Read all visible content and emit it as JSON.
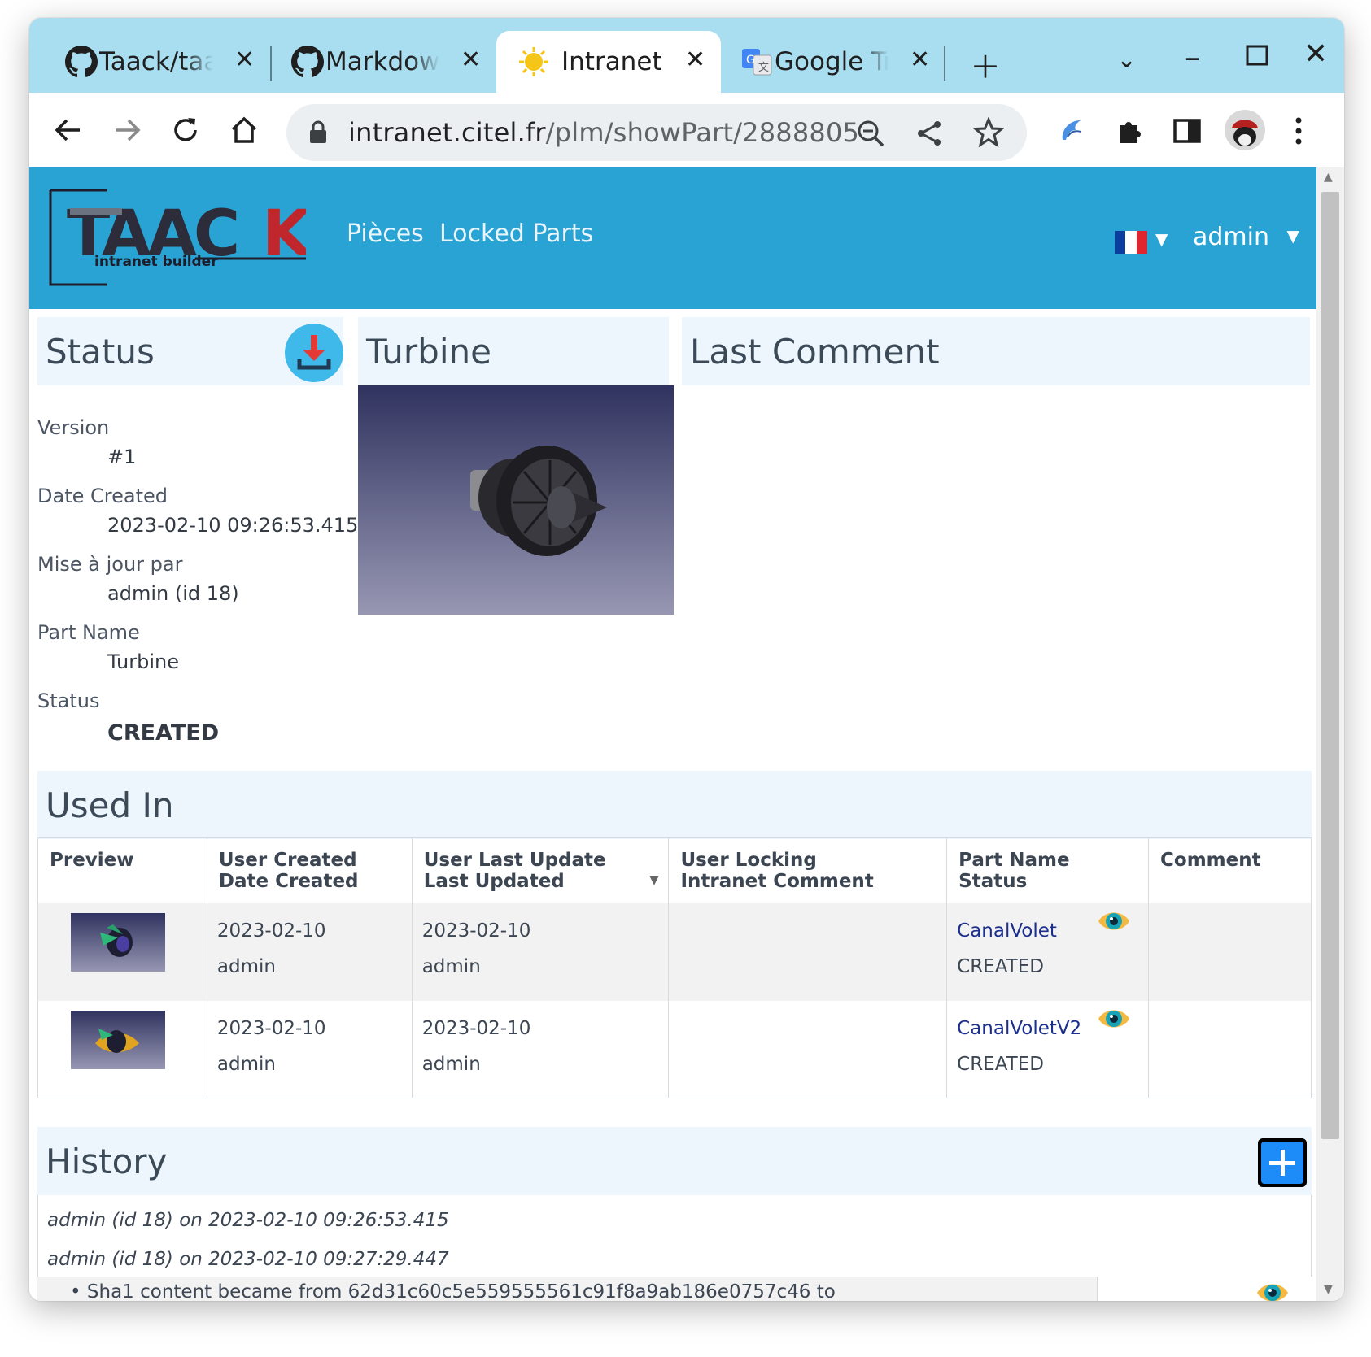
{
  "browser": {
    "tabs": [
      {
        "title": "Taack/taack-ui",
        "icon": "github-icon"
      },
      {
        "title": "Markdown",
        "icon": "github-icon"
      },
      {
        "title": "Intranet",
        "icon": "sun-icon"
      },
      {
        "title": "Google Translate",
        "icon": "google-translate-icon"
      }
    ],
    "url_host": "intranet.citel.fr",
    "url_path": "/plm/showPart/2888805"
  },
  "header": {
    "logo_text": "TAACK",
    "logo_sub": "intranet builder",
    "nav": [
      "Pièces",
      "Locked Parts"
    ],
    "user": "admin"
  },
  "status_panel": {
    "title": "Status",
    "fields": [
      {
        "label": "Version",
        "value": "#1"
      },
      {
        "label": "Date Created",
        "value": "2023-02-10 09:26:53.415"
      },
      {
        "label": "Mise à jour par",
        "value": "admin (id 18)"
      },
      {
        "label": "Part Name",
        "value": "Turbine"
      },
      {
        "label": "Status",
        "value": "CREATED"
      }
    ]
  },
  "preview_panel": {
    "title": "Turbine"
  },
  "comment_panel": {
    "title": "Last Comment"
  },
  "used_in": {
    "title": "Used In",
    "columns": [
      {
        "line1": "Preview",
        "line2": ""
      },
      {
        "line1": "User Created",
        "line2": "Date Created"
      },
      {
        "line1": "User Last Update",
        "line2": "Last Updated"
      },
      {
        "line1": "User Locking",
        "line2": "Intranet Comment"
      },
      {
        "line1": "Part Name",
        "line2": "Status"
      },
      {
        "line1": "Comment",
        "line2": ""
      }
    ],
    "rows": [
      {
        "created_date": "2023-02-10",
        "created_user": "admin",
        "updated_date": "2023-02-10",
        "updated_user": "admin",
        "part_name": "CanalVolet",
        "status": "CREATED"
      },
      {
        "created_date": "2023-02-10",
        "created_user": "admin",
        "updated_date": "2023-02-10",
        "updated_user": "admin",
        "part_name": "CanalVoletV2",
        "status": "CREATED"
      }
    ]
  },
  "history": {
    "title": "History",
    "entries": [
      "admin (id 18) on 2023-02-10 09:26:53.415",
      "admin (id 18) on 2023-02-10 09:27:29.447"
    ],
    "change": "Sha1 content became from 62d31c60c5e559555561c91f8a9ab186e0757c46 to"
  },
  "colors": {
    "header": "#29a3d4",
    "panel": "#eef6fd",
    "tabstrip": "#a8def0",
    "add_button": "#1d8cf8"
  }
}
